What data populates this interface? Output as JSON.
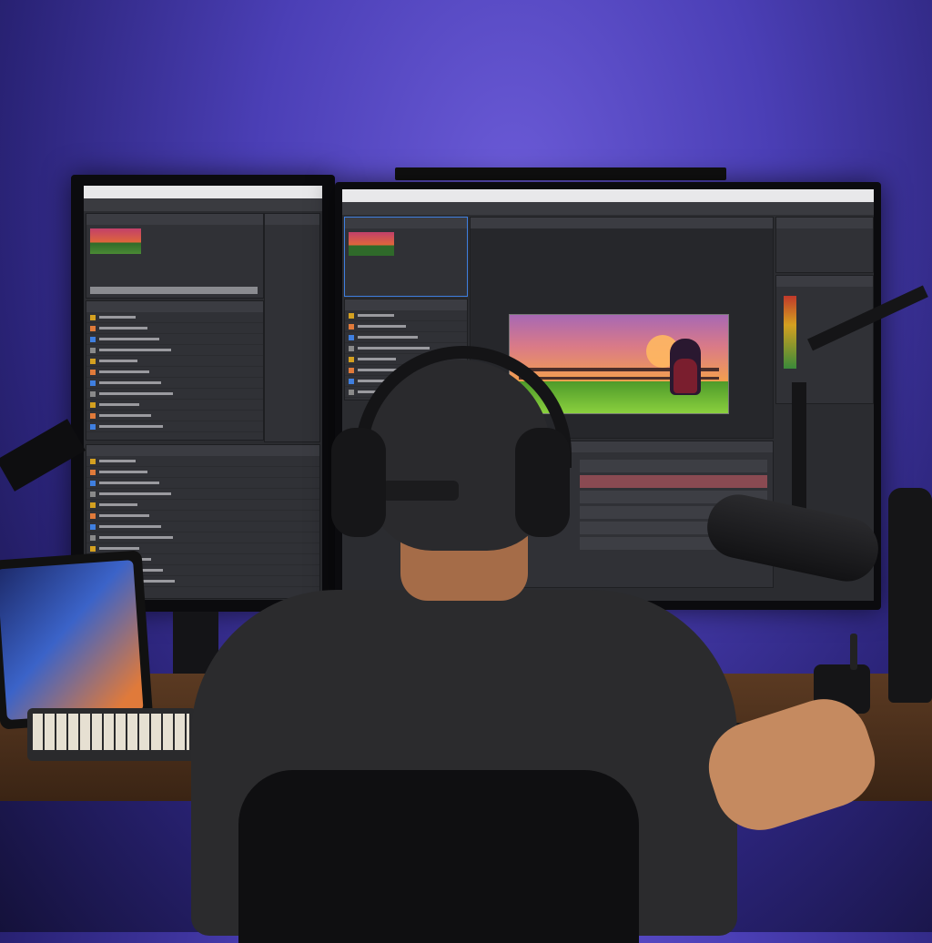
{
  "scene": {
    "description_tags": [
      "person-back-view",
      "headphones",
      "cap",
      "dual-monitors",
      "video-editing-software",
      "microphone-arm",
      "tablet",
      "keyboard",
      "desk"
    ],
    "colors": {
      "wall": "#4b3fb6",
      "desk": "#5b3a22",
      "shirt": "#2b2b2d",
      "ui_bg": "#2b2c30",
      "preview_sky_top": "#c07aa8",
      "preview_sky_bottom": "#f2a04a",
      "preview_grass": "#7bc23a",
      "selection_blue": "#3f7fe0",
      "timeline_track": "#8a4a52"
    }
  },
  "left_monitor": {
    "title": "",
    "menu": "",
    "project_panel_rows": 11,
    "layer_rows": 12
  },
  "right_monitor": {
    "title": "",
    "menu": "",
    "composition_tab": "",
    "timeline_tracks": 6
  },
  "icons": [
    "headphones-icon",
    "microphone-icon",
    "tablet-icon",
    "keyboard-icon",
    "bottle-icon",
    "pen-holder-icon"
  ]
}
